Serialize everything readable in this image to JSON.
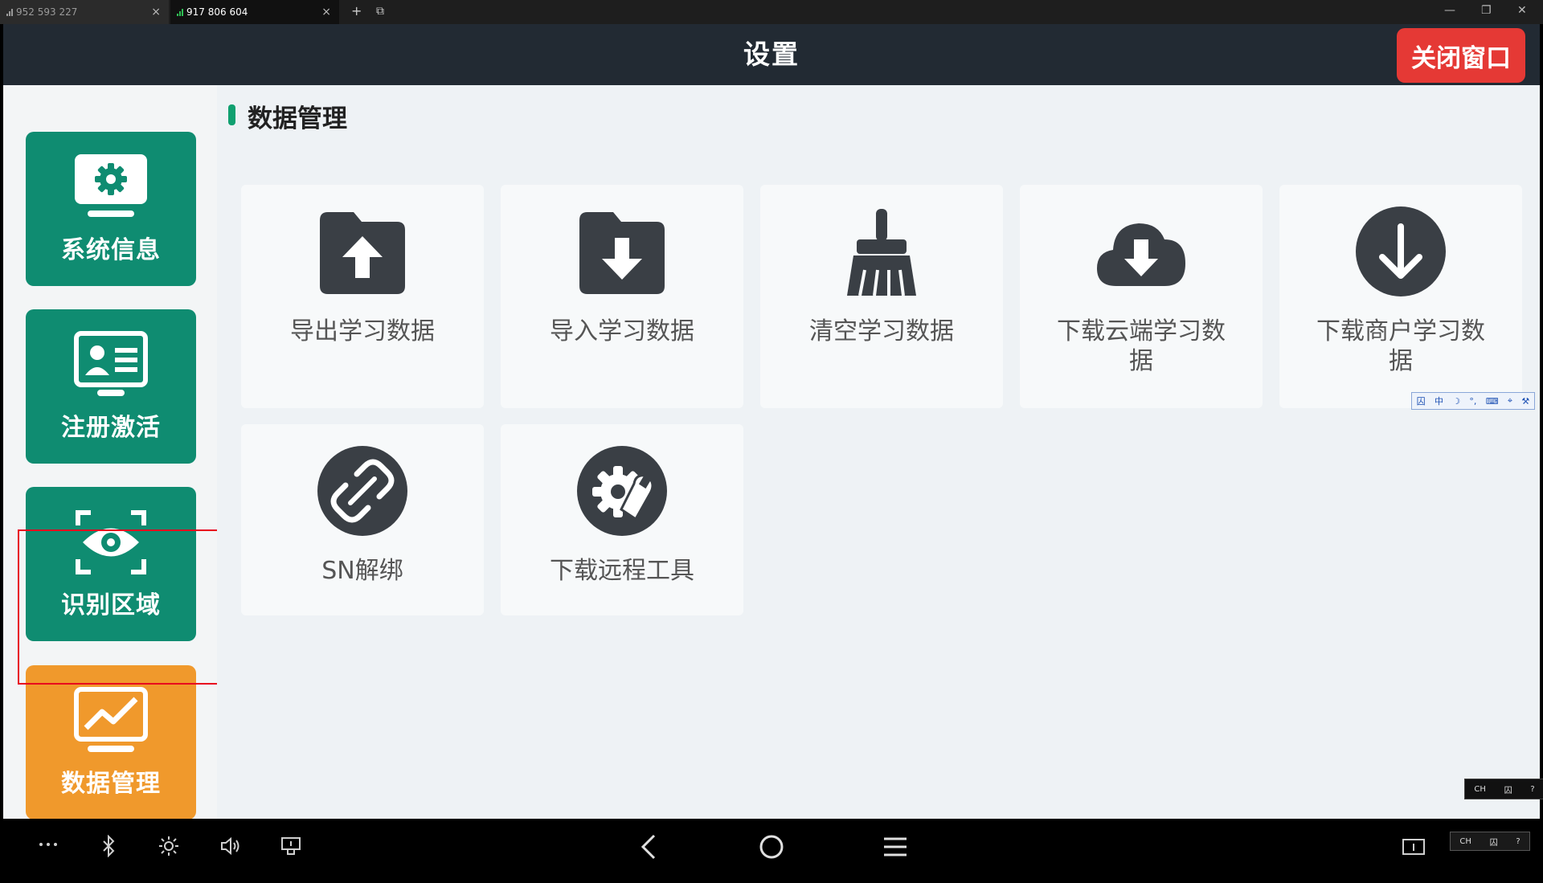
{
  "remote_tabs": [
    {
      "label": "952 593 227",
      "close": "×"
    },
    {
      "label": "917 806 604",
      "close": "×"
    }
  ],
  "tab_controls": {
    "new_tab": "+",
    "restore": "⧉"
  },
  "window_controls": {
    "minimize": "—",
    "maximize": "❐",
    "close": "✕"
  },
  "app": {
    "title": "设置",
    "close_window_label": "关闭窗口"
  },
  "sidebar": {
    "items": [
      {
        "label": "系统信息",
        "icon": "monitor-gear-icon",
        "color": "#0f8c71"
      },
      {
        "label": "注册激活",
        "icon": "id-card-icon",
        "color": "#0f8c71"
      },
      {
        "label": "识别区域",
        "icon": "eye-scan-icon",
        "color": "#0f8c71",
        "highlighted": true
      },
      {
        "label": "数据管理",
        "icon": "monitor-chart-icon",
        "color": "#f0992c",
        "active": true
      }
    ]
  },
  "section": {
    "title": "数据管理",
    "accent_color": "#10a070",
    "cards": [
      {
        "label": "导出学习数据",
        "icon": "folder-upload-icon"
      },
      {
        "label": "导入学习数据",
        "icon": "folder-download-icon"
      },
      {
        "label": "清空学习数据",
        "icon": "broom-icon"
      },
      {
        "label": "下载云端学习数\n据",
        "icon": "cloud-download-icon"
      },
      {
        "label": "下载商户学习数\n据",
        "icon": "circle-arrow-down-icon"
      },
      {
        "label": "SN解绑",
        "icon": "unlink-icon"
      },
      {
        "label": "下载远程工具",
        "icon": "gear-wrench-icon"
      }
    ]
  },
  "ime": {
    "bar": [
      "囚",
      "中",
      "☽",
      "°,",
      "⌨",
      "⌖",
      "⚒"
    ],
    "tray": [
      "CH",
      "囚",
      "?"
    ]
  },
  "colors": {
    "titlebar": "#222a33",
    "close_button": "#e53935",
    "teal": "#0f8c71",
    "orange": "#f0992c",
    "icon_dark": "#3a3f45"
  }
}
